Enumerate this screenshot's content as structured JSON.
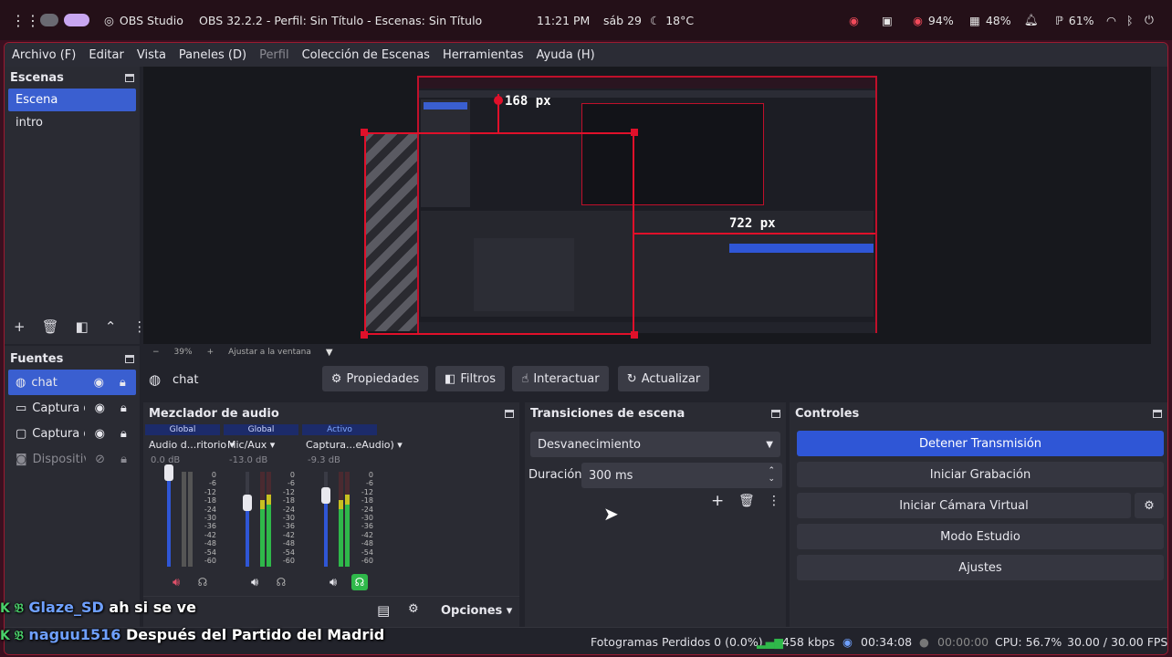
{
  "taskbar": {
    "app_name": "OBS Studio",
    "window_title": "OBS 32.2.2 - Perfil: Sin Título - Escenas: Sin Título",
    "time": "11:21 PM",
    "date": "sáb 29",
    "weather": "18°C",
    "battery": "94%",
    "memory": "48%",
    "cpu": "61%"
  },
  "menu": [
    "Archivo (F)",
    "Editar",
    "Vista",
    "Paneles (D)",
    "Perfil",
    "Colección de Escenas",
    "Herramientas",
    "Ayuda (H)"
  ],
  "scenes": {
    "title": "Escenas",
    "items": [
      "Escena",
      "intro"
    ]
  },
  "sources": {
    "title": "Fuentes",
    "items": [
      "chat",
      "Captura d",
      "Captura d",
      "Dispositiv"
    ]
  },
  "preview": {
    "zoom": "39%",
    "fit": "Ajustar a la ventana",
    "label_top": "168 px",
    "label_right": "722 px"
  },
  "source_toolbar": {
    "name": "chat",
    "properties": "Propiedades",
    "filters": "Filtros",
    "interact": "Interactuar",
    "refresh": "Actualizar"
  },
  "mixer": {
    "title": "Mezclador de audio",
    "channels": [
      {
        "tag": "Global",
        "name": "Audio d...ritorio",
        "db": "0.0 dB",
        "level": 1.0
      },
      {
        "tag": "Global",
        "name": "Mic/Aux",
        "db": "-13.0 dB",
        "level": 0.68
      },
      {
        "tag": "Activo",
        "name": "Captura...eAudio)",
        "db": "-9.3 dB",
        "level": 0.76
      }
    ],
    "ticks": [
      "0",
      "-6",
      "-12",
      "-18",
      "-24",
      "-30",
      "-36",
      "-42",
      "-48",
      "-54",
      "-60"
    ],
    "options": "Opciones"
  },
  "transitions": {
    "title": "Transiciones de escena",
    "type": "Desvanecimiento",
    "duration_label": "Duración",
    "duration": "300 ms"
  },
  "controls": {
    "title": "Controles",
    "stop_stream": "Detener Transmisión",
    "start_record": "Iniciar Grabación",
    "virtual_cam": "Iniciar Cámara Virtual",
    "studio_mode": "Modo Estudio",
    "settings": "Ajustes"
  },
  "status": {
    "dropped": "Fotogramas Perdidos 0 (0.0%)",
    "bitrate": "458 kbps",
    "stream_time": "00:34:08",
    "rec_time": "00:00:00",
    "cpu": "CPU: 56.7%",
    "fps": "30.00 / 30.00 FPS"
  },
  "chat_overlay": [
    {
      "user": "Glaze_SD",
      "message": "ah si se ve"
    },
    {
      "user": "naguu1516",
      "message": "Después del Partido del Madrid"
    }
  ],
  "colors": {
    "accent": "#2f56d6",
    "selection": "#3a5fd0",
    "bounding_box": "#e0102a",
    "meter_green": "#2fb84a",
    "user_color": "#6fa0ff"
  }
}
